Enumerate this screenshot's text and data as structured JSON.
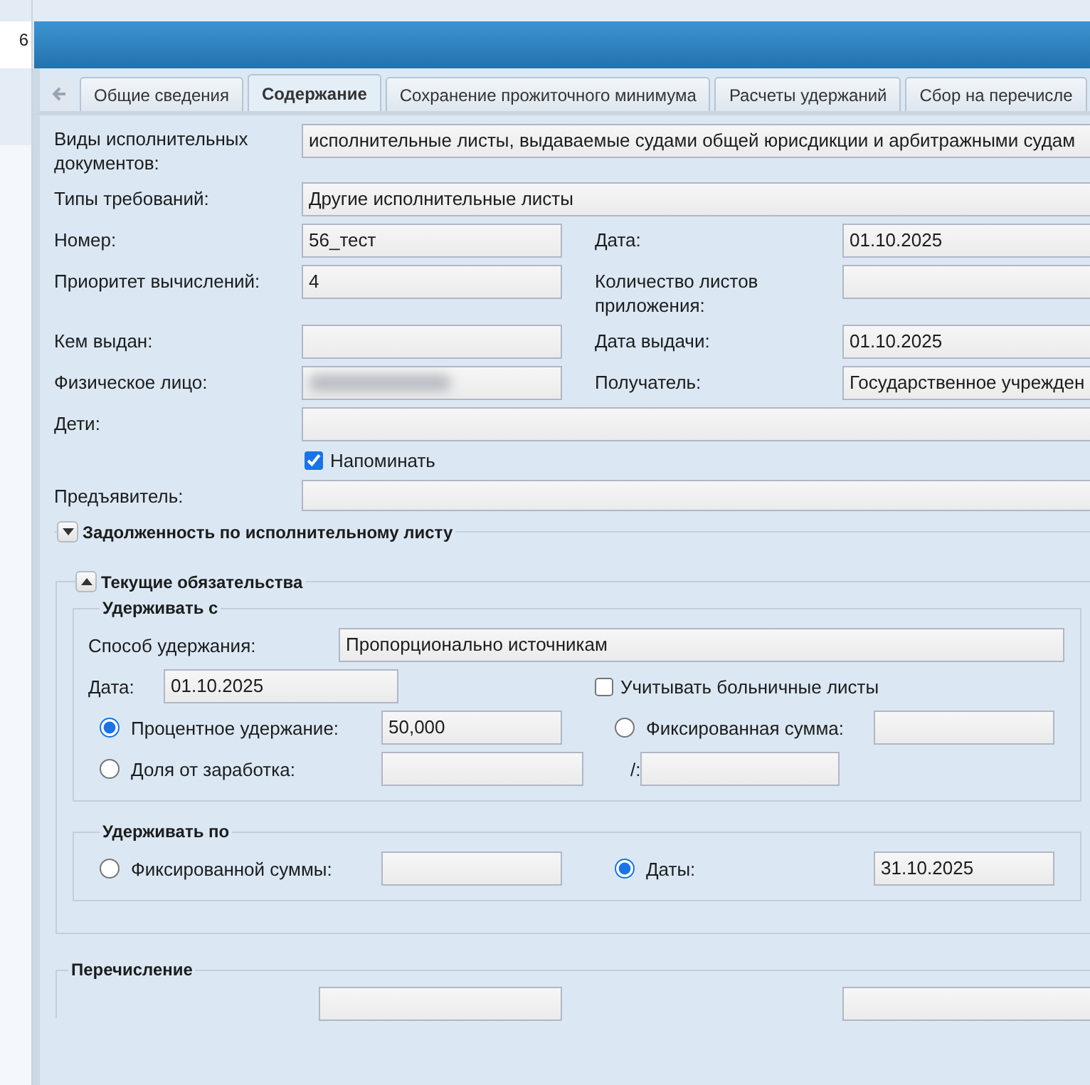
{
  "sidebar": {
    "text": "6"
  },
  "tabs": [
    {
      "label": "Общие сведения",
      "selected": false
    },
    {
      "label": "Содержание",
      "selected": true
    },
    {
      "label": "Сохранение прожиточного минимума",
      "selected": false
    },
    {
      "label": "Расчеты удержаний",
      "selected": false
    },
    {
      "label": "Сбор на перечисле",
      "selected": false
    }
  ],
  "form": {
    "doc_types": {
      "label": "Виды исполнительных документов:",
      "value": "исполнительные листы, выдаваемые судами общей юрисдикции и арбитражными судам"
    },
    "claim_types": {
      "label": "Типы требований:",
      "value": "Другие исполнительные листы"
    },
    "pairs": [
      {
        "left": {
          "label": "Номер:",
          "value": "56_тест",
          "obscured": false
        },
        "right": {
          "label": "Дата:",
          "value": "01.10.2025"
        }
      },
      {
        "left": {
          "label": "Приоритет вычислений:",
          "value": "4",
          "obscured": false
        },
        "right": {
          "label": "Количество листов приложения:"
        }
      },
      {
        "left": {
          "label": "Кем выдан:",
          "obscured": false
        },
        "right": {
          "label": "Дата выдачи:",
          "value": "01.10.2025"
        }
      },
      {
        "left": {
          "label": "Физическое лицо:",
          "obscured": true
        },
        "right": {
          "label": "Получатель:",
          "value": "Государственное учрежден"
        }
      }
    ],
    "children": {
      "label": "Дети:"
    },
    "remind": {
      "label": "Напоминать",
      "checked": true
    },
    "presenter": {
      "label": "Предъявитель:"
    }
  },
  "debt_section": {
    "title": "Задолженность по исполнительному листу",
    "expanded": false
  },
  "current": {
    "title": "Текущие обязательства",
    "expanded": true,
    "from": {
      "title": "Удерживать с",
      "method_label": "Способ удержания:",
      "method_value": "Пропорционально источникам",
      "date_label": "Дата:",
      "date_value": "01.10.2025",
      "sick": {
        "label": "Учитывать больничные листы",
        "checked": false
      },
      "options": [
        {
          "label": "Процентное удержание:",
          "value": "50,000",
          "selected": true
        },
        {
          "label": "Фиксированная сумма:",
          "selected": false
        },
        {
          "label": "Доля от заработка:",
          "selected": false
        }
      ],
      "ratio_sep": "/:"
    },
    "until": {
      "title": "Удерживать по",
      "options": [
        {
          "label": "Фиксированной суммы:",
          "selected": false
        },
        {
          "label": "Даты:",
          "value": "31.10.2025",
          "selected": true
        }
      ]
    }
  },
  "transfer": {
    "title": "Перечисление"
  }
}
